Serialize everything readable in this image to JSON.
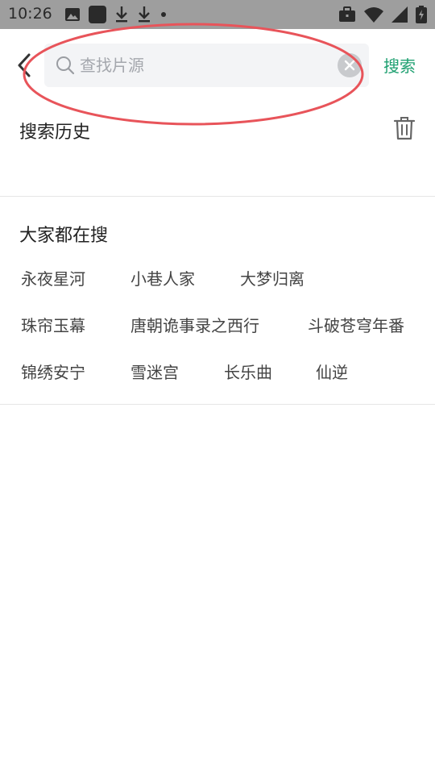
{
  "status_bar": {
    "time": "10:26",
    "icons_left": [
      "image-icon",
      "app-square-icon",
      "download-icon",
      "download-icon",
      "dot-icon"
    ],
    "icons_right": [
      "briefcase-icon",
      "wifi-icon",
      "cell-signal-icon",
      "battery-icon"
    ]
  },
  "search": {
    "placeholder": "查找片源",
    "value": "",
    "submit_label": "搜索",
    "accent_color": "#1fa071"
  },
  "history": {
    "title": "搜索历史",
    "items": []
  },
  "hot": {
    "title": "大家都在搜",
    "tags": [
      "永夜星河",
      "小巷人家",
      "大梦归离",
      "珠帘玉幕",
      "唐朝诡事录之西行",
      "斗破苍穹年番",
      "锦绣安宁",
      "雪迷宫",
      "长乐曲",
      "仙逆"
    ]
  },
  "annotation_color": "#e8545a"
}
